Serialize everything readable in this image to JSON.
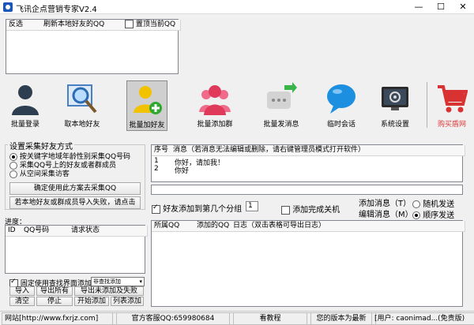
{
  "window": {
    "title": "飞讯企点营销专家V2.4",
    "minimize": "—",
    "maximize": "☐",
    "close": "✕"
  },
  "top_table": {
    "headers": [
      "反选",
      "刷新本地好友的QQ",
      "置顶当前QQ"
    ]
  },
  "toolbar": {
    "items": [
      {
        "label": "批量登录",
        "icon": "user-silhouette-icon"
      },
      {
        "label": "取本地好友",
        "icon": "magnifier-icon"
      },
      {
        "label": "批量加好友",
        "icon": "add-friend-icon"
      },
      {
        "label": "批量添加群",
        "icon": "group-icon"
      },
      {
        "label": "批量发消息",
        "icon": "send-message-icon"
      },
      {
        "label": "临时会话",
        "icon": "chat-bubble-icon"
      },
      {
        "label": "系统设置",
        "icon": "settings-monitor-icon"
      },
      {
        "label": "购买盾网",
        "icon": "shopping-cart-icon"
      }
    ]
  },
  "collect": {
    "legend": "设置采集好友方式",
    "options": [
      "按关键字地域年龄性别采集QQ号码",
      "采集QQ号上的好友或者群成员",
      "从空间采集访客"
    ],
    "confirm_button": "确定使用此方案去采集QQ",
    "import_button": "若本地好友或群成员导入失败，请点击"
  },
  "messages": {
    "headers": [
      "序号",
      "消息（若消息无法编辑或删除，请右键管理员模式打开软件）"
    ],
    "rows": [
      {
        "no": "1",
        "text": "你好，请加我！"
      },
      {
        "no": "2",
        "text": "你好"
      }
    ],
    "add_button": "添加消息（T）",
    "edit_button": "编辑消息（M）",
    "random_send": "随机发送",
    "order_send": "顺序发送"
  },
  "group_setting": {
    "label": "好友添加到第几个分组",
    "value": "1",
    "shutdown_label": "添加完成关机"
  },
  "progress": {
    "label": "进度：",
    "headers": [
      "ID",
      "QQ号码",
      "请求状态"
    ]
  },
  "log_table": {
    "headers": [
      "所属QQ",
      "添加的QQ",
      "日志（双击表格可导出日志）"
    ]
  },
  "bottom_left": {
    "fixed_label": "固定使用查找界面添加",
    "mode_value": "非查找添加",
    "buttons": [
      "导入",
      "导出所有",
      "导出未添加及失败",
      "清空",
      "停止",
      "开始添加",
      "列表添加"
    ]
  },
  "status": {
    "site": "网站[http://www.fxrjz.com]",
    "service": "官方客服QQ:659980684",
    "tutorial": "看教程",
    "version": "您的版本为最新",
    "user": "[用户: caonimad...(免责版)"
  },
  "colors": {
    "accent_red": "#e03a3a",
    "toolbar_selected": "#cfcfcf"
  }
}
